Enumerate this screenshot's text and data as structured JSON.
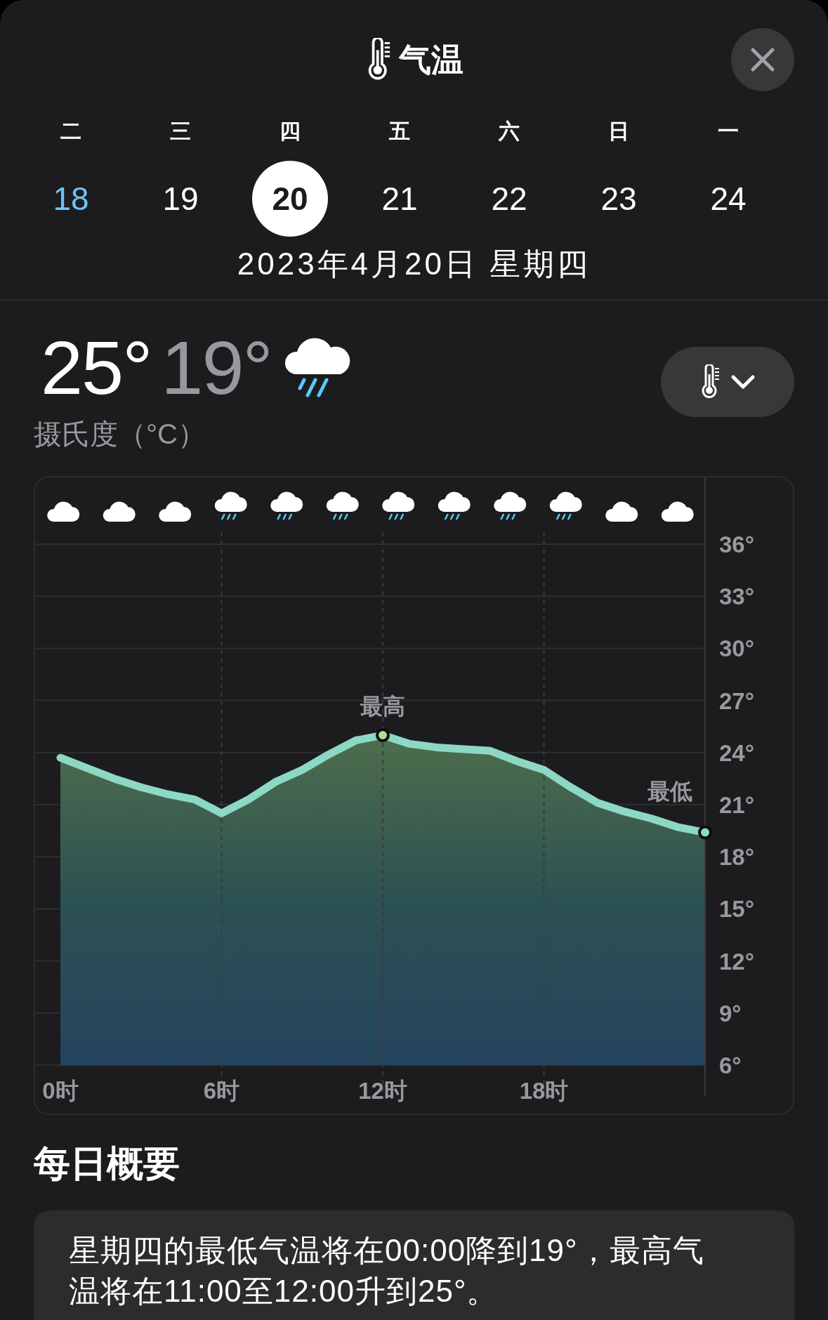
{
  "header": {
    "title": "气温"
  },
  "days": [
    {
      "weekday": "二",
      "date": "18",
      "today": true,
      "selected": false
    },
    {
      "weekday": "三",
      "date": "19",
      "today": false,
      "selected": false
    },
    {
      "weekday": "四",
      "date": "20",
      "today": false,
      "selected": true
    },
    {
      "weekday": "五",
      "date": "21",
      "today": false,
      "selected": false
    },
    {
      "weekday": "六",
      "date": "22",
      "today": false,
      "selected": false
    },
    {
      "weekday": "日",
      "date": "23",
      "today": false,
      "selected": false
    },
    {
      "weekday": "一",
      "date": "24",
      "today": false,
      "selected": false
    }
  ],
  "date_label": "2023年4月20日 星期四",
  "current": {
    "high": "25°",
    "low": "19°",
    "unit": "摄氏度（°C）"
  },
  "chart": {
    "hourly_icons": [
      {
        "kind": "cloud"
      },
      {
        "kind": "cloud"
      },
      {
        "kind": "cloud"
      },
      {
        "kind": "rain"
      },
      {
        "kind": "rain"
      },
      {
        "kind": "rain"
      },
      {
        "kind": "rain"
      },
      {
        "kind": "rain"
      },
      {
        "kind": "rain"
      },
      {
        "kind": "rain"
      },
      {
        "kind": "cloud"
      },
      {
        "kind": "cloud"
      }
    ],
    "chart_data": {
      "type": "area",
      "x": [
        0,
        1,
        2,
        3,
        4,
        5,
        6,
        7,
        8,
        9,
        10,
        11,
        12,
        13,
        14,
        15,
        16,
        17,
        18,
        19,
        20,
        21,
        22,
        23,
        24
      ],
      "grid": true,
      "series": [
        {
          "color": "#8cd8c4",
          "values": [
            23.7,
            23.1,
            22.5,
            22.0,
            21.6,
            21.3,
            20.5,
            21.3,
            22.3,
            23.0,
            23.9,
            24.7,
            25.0,
            24.5,
            24.3,
            24.2,
            24.1,
            23.5,
            23.0,
            22.0,
            21.1,
            20.6,
            20.2,
            19.7,
            19.4
          ]
        }
      ],
      "xlim": [
        0,
        24
      ],
      "ylim": [
        6,
        36
      ],
      "xticks": [
        {
          "value": 0,
          "label": "0时"
        },
        {
          "value": 6,
          "label": "6时"
        },
        {
          "value": 12,
          "label": "12时"
        },
        {
          "value": 18,
          "label": "18时"
        }
      ],
      "yticks": [
        {
          "value": 6,
          "label": "6°"
        },
        {
          "value": 9,
          "label": "9°"
        },
        {
          "value": 12,
          "label": "12°"
        },
        {
          "value": 15,
          "label": "15°"
        },
        {
          "value": 18,
          "label": "18°"
        },
        {
          "value": 21,
          "label": "21°"
        },
        {
          "value": 24,
          "label": "24°"
        },
        {
          "value": 27,
          "label": "27°"
        },
        {
          "value": 30,
          "label": "30°"
        },
        {
          "value": 33,
          "label": "33°"
        },
        {
          "value": 36,
          "label": "36°"
        }
      ],
      "annotations": [
        {
          "x": 12,
          "y": 25.0,
          "text": "最高"
        },
        {
          "x": 24,
          "y": 19.4,
          "text": "最低"
        }
      ]
    }
  },
  "section_title": "每日概要",
  "summary_text": "星期四的最低气温将在00:00降到19°，最高气温将在11:00至12:00升到25°。"
}
